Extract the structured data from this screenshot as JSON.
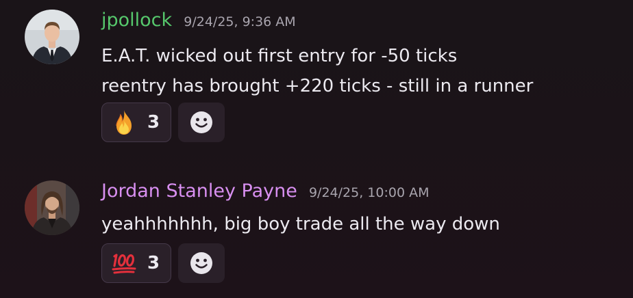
{
  "messages": [
    {
      "username": "jpollock",
      "username_color": "#56c86c",
      "timestamp": "9/24/25, 9:36 AM",
      "lines": [
        "E.A.T. wicked out first entry for -50 ticks",
        "reentry has brought +220 ticks - still in a runner"
      ],
      "reaction": {
        "emoji_icon": "fire-icon",
        "count": "3"
      },
      "add_reaction_icon": "smiley-face-icon"
    },
    {
      "username": "Jordan Stanley Payne",
      "username_color": "#d88ff0",
      "timestamp": "9/24/25, 10:00 AM",
      "lines": [
        "yeahhhhhhh, big boy trade all the way down"
      ],
      "reaction": {
        "emoji_icon": "hundred-points-icon",
        "count": "3"
      },
      "add_reaction_icon": "smiley-face-icon"
    }
  ],
  "colors": {
    "background": "#1b1318",
    "reaction_bg": "#2a2029",
    "reaction_border": "#45394a",
    "timestamp": "#a9a5ae",
    "text": "#eceaf0"
  }
}
